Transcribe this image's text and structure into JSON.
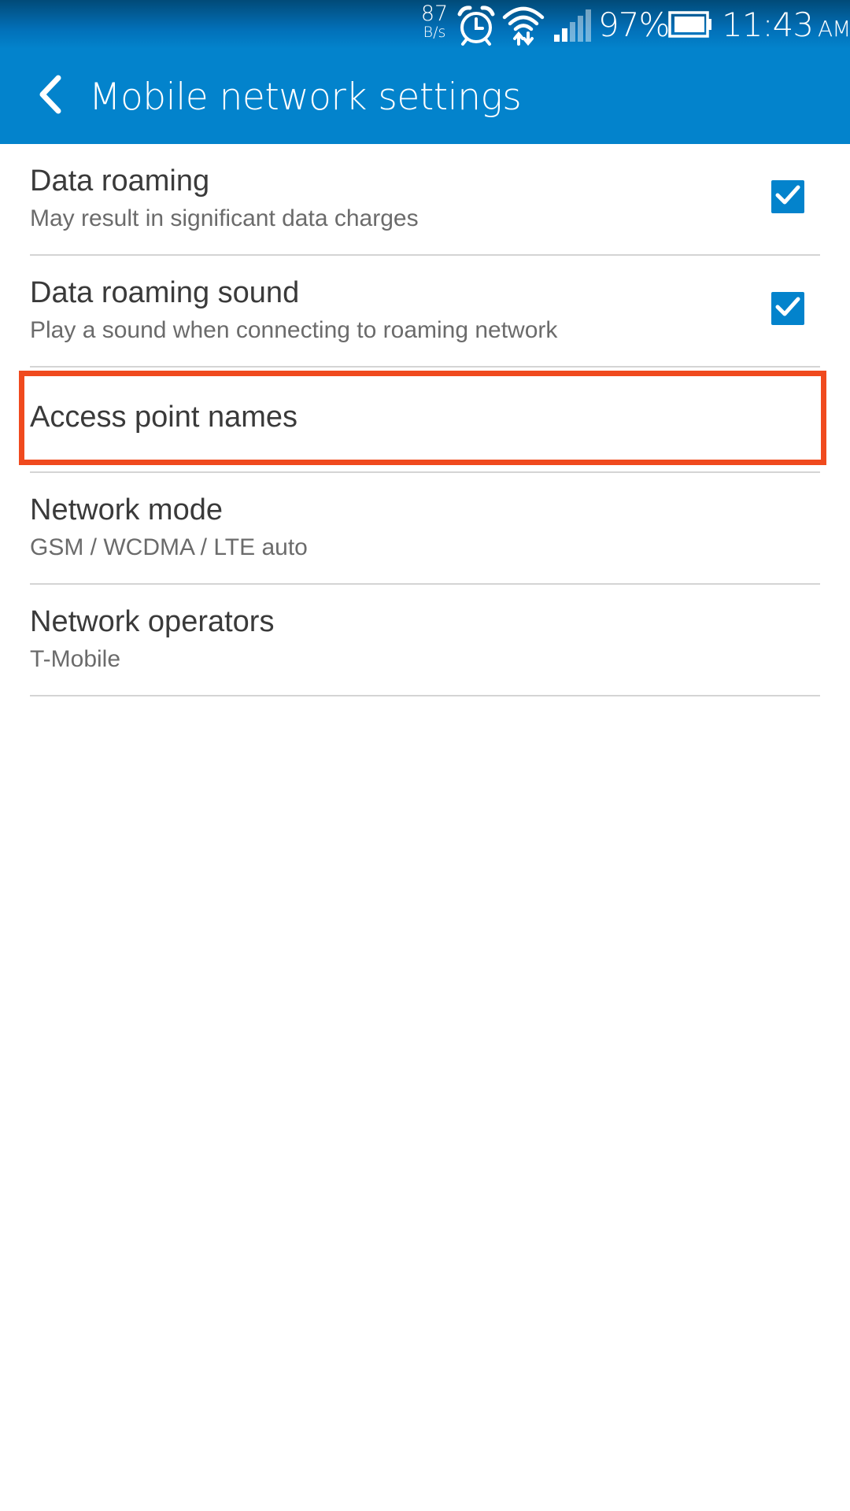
{
  "status_bar": {
    "speed_value": "87",
    "speed_unit": "B/s",
    "battery_percent": "97%",
    "time": "11:43",
    "time_suffix": "AM",
    "icons": [
      "alarm-icon",
      "wifi-icon",
      "signal-icon",
      "battery-icon"
    ]
  },
  "app_bar": {
    "title": "Mobile network settings",
    "back_icon": "back-arrow-icon"
  },
  "settings": [
    {
      "title": "Data roaming",
      "subtitle": "May result in significant data charges",
      "checked": true
    },
    {
      "title": "Data roaming sound",
      "subtitle": "Play a sound when connecting to roaming network",
      "checked": true
    },
    {
      "title": "Access point names",
      "highlighted": true
    },
    {
      "title": "Network mode",
      "subtitle": "GSM / WCDMA / LTE auto"
    },
    {
      "title": "Network operators",
      "subtitle": "T-Mobile"
    }
  ],
  "colors": {
    "accent": "#0383cc",
    "highlight": "#f04a1e",
    "divider": "#d4d4d4"
  }
}
